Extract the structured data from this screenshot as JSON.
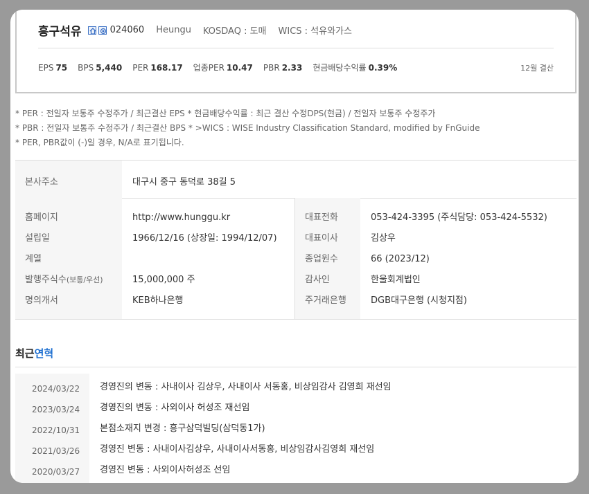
{
  "company": {
    "name": "흥구석유",
    "code": "024060",
    "eng_name": "Heungu",
    "market": "KOSDAQ : 도매",
    "wics": "WICS : 석유와가스",
    "icons": [
      "home-icon",
      "ir-icon"
    ]
  },
  "stats": [
    {
      "label": "EPS",
      "value": "75"
    },
    {
      "label": "BPS",
      "value": "5,440"
    },
    {
      "label": "PER",
      "value": "168.17"
    },
    {
      "label": "업종PER",
      "value": "10.47"
    },
    {
      "label": "PBR",
      "value": "2.33"
    },
    {
      "label": "현금배당수익률",
      "value": "0.39%"
    }
  ],
  "settlement": "12월 결산",
  "notes": [
    "* PER : 전일자 보통주 수정주가 / 최근결산 EPS * 현금배당수익률 : 최근 결산 수정DPS(현금) / 전일자 보통주 수정주가",
    "* PBR : 전일자 보통주 수정주가 / 최근결산 BPS * >WICS : WISE Industry Classification Standard, modified by FnGuide",
    "* PER, PBR값이 (-)일 경우, N/A로 표기됩니다."
  ],
  "address": {
    "label": "본사주소",
    "value": "대구시 중구 동덕로 38길 5"
  },
  "info_left": [
    {
      "label": "홈페이지",
      "value": "http://www.hunggu.kr"
    },
    {
      "label": "설립일",
      "value": "1966/12/16 (상장일: 1994/12/07)"
    },
    {
      "label": "계열",
      "value": ""
    },
    {
      "label": "발행주식수",
      "label_small": "(보통/우선)",
      "value": "15,000,000 주"
    },
    {
      "label": "명의개서",
      "value": "KEB하나은행"
    }
  ],
  "info_right": [
    {
      "label": "대표전화",
      "value": "053-424-3395 (주식담당: 053-424-5532)"
    },
    {
      "label": "대표이사",
      "value": "김상우"
    },
    {
      "label": "종업원수",
      "value": "66 (2023/12)"
    },
    {
      "label": "감사인",
      "value": "한울회계법인"
    },
    {
      "label": "주거래은행",
      "value": "DGB대구은행 (시청지점)"
    }
  ],
  "history": {
    "title_plain": "최근",
    "title_accent": "연혁",
    "items": [
      {
        "date": "2024/03/22",
        "text": "경영진의 변동 : 사내이사 김상우, 사내이사 서동홍, 비상임감사 김영희 재선임"
      },
      {
        "date": "2023/03/24",
        "text": "경영진의 변동 : 사외이사 허성조 재선임"
      },
      {
        "date": "2022/10/31",
        "text": "본점소재지 변경 : 흥구삼덕빌딩(삼덕동1가)"
      },
      {
        "date": "2021/03/26",
        "text": "경영진 변동 : 사내이사김상우, 사내이사서동홍, 비상임감사김영희 재선임"
      },
      {
        "date": "2020/03/27",
        "text": "경영진 변동 : 사외이사허성조 선임"
      }
    ]
  }
}
